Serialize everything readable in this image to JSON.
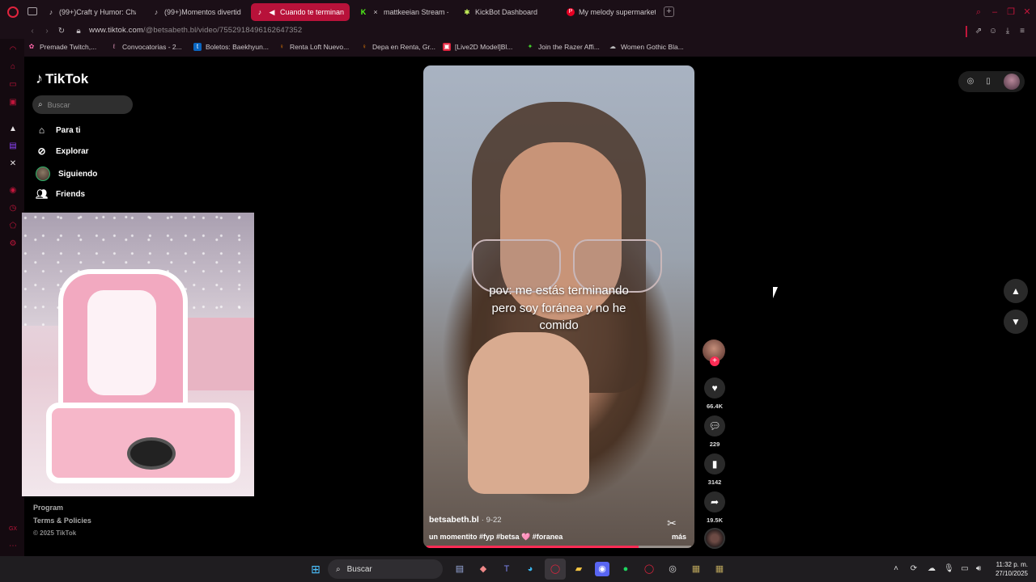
{
  "browser": {
    "tabs": [
      {
        "label": "(99+)Craft y Humor: Cha",
        "icon": "tiktok-icon"
      },
      {
        "label": "(99+)Momentos divertido",
        "icon": "tiktok-icon"
      },
      {
        "label": "Cuando te terminan s",
        "icon": "tiktok-icon",
        "active": true
      },
      {
        "label": "mattkeeian Stream - V",
        "icon": "kick-icon"
      },
      {
        "label": "KickBot Dashboard",
        "icon": "kickbot-icon"
      },
      {
        "label": "My melody supermarket",
        "icon": "pinterest-icon"
      }
    ],
    "url_host": "www.tiktok.com",
    "url_path": "/@betsabeth.bl/video/7552918496162647352",
    "bookmarks": [
      {
        "label": "Premade Twitch,..."
      },
      {
        "label": "Convocatorias - 2..."
      },
      {
        "label": "Boletos: Baekhyun..."
      },
      {
        "label": "Renta Loft Nuevo..."
      },
      {
        "label": "Depa en Renta, Gr..."
      },
      {
        "label": "[Live2D Model]Bl..."
      },
      {
        "label": "Join the Razer Affi..."
      },
      {
        "label": "Women Gothic Bla..."
      }
    ]
  },
  "tiktok": {
    "logo": "TikTok",
    "search_placeholder": "Buscar",
    "nav": [
      {
        "label": "Para ti",
        "icon": "home-icon"
      },
      {
        "label": "Explorar",
        "icon": "compass-icon"
      },
      {
        "label": "Siguiendo",
        "icon": "following-avatar"
      },
      {
        "label": "Friends",
        "icon": "friends-icon"
      }
    ],
    "footer": [
      "Program",
      "Terms & Policies"
    ],
    "copyright": "© 2025 TikTok",
    "video": {
      "caption_lines": [
        "pov: me estás terminando",
        "pero soy foránea y no he",
        "comido"
      ],
      "author": "betsabeth.bl",
      "date": "· 9-22",
      "description": "un momentito #fyp #betsa 🩷 #foranea",
      "more": "más",
      "progress": 0.8
    },
    "actions": {
      "likes": "66.4K",
      "comments": "229",
      "saves": "3142",
      "shares": "19.5K"
    }
  },
  "taskbar": {
    "search_label": "Buscar",
    "time": "11:32 p. m.",
    "date": "27/10/2025"
  }
}
